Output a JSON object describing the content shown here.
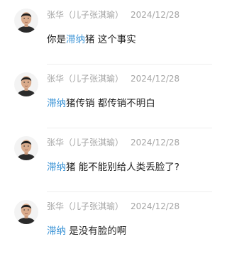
{
  "accent_color": "#3a93d6",
  "comments": [
    {
      "author": "张华（儿子张淇瑜）",
      "date": "2024/12/28",
      "tag": "滞纳",
      "text_before": "你是",
      "text_after": "猪 这个事实"
    },
    {
      "author": "张华（儿子张淇瑜）",
      "date": "2024/12/28",
      "tag": "滞纳",
      "text_before": "",
      "text_after": "猪传销 都传销不明白"
    },
    {
      "author": "张华（儿子张淇瑜）",
      "date": "2024/12/28",
      "tag": "滞纳",
      "text_before": "",
      "text_after": "猪 能不能别给人类丢脸了?"
    },
    {
      "author": "张华（儿子张淇瑜）",
      "date": "2024/12/28",
      "tag": "滞纳",
      "text_before": "",
      "text_after": " 是没有脸的啊"
    }
  ]
}
